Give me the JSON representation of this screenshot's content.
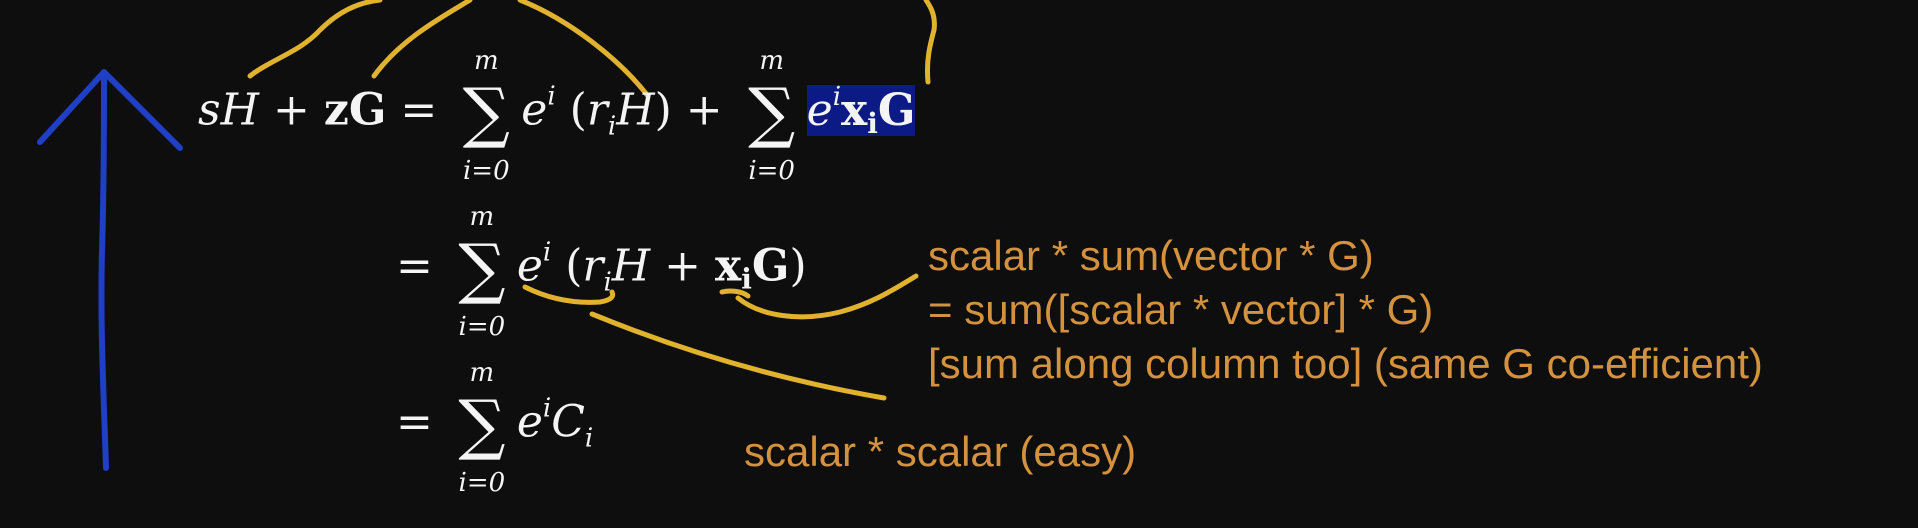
{
  "equations": {
    "line1": {
      "lhs_s": "s",
      "lhs_H": "H",
      "plus": "+",
      "lhs_z": "z",
      "lhs_G": "G",
      "equals": "=",
      "sum_upper": "m",
      "sum_lower": "i=0",
      "sigma": "∑",
      "e": "e",
      "i_sup": "i",
      "lparen": "(",
      "r": "r",
      "i_sub": "i",
      "H": "H",
      "rparen": ")",
      "plus2": "+",
      "x": "x",
      "x_sub": "i",
      "G": "G"
    },
    "line2": {
      "equals": "=",
      "sum_upper": "m",
      "sum_lower": "i=0",
      "sigma": "∑",
      "e": "e",
      "i_sup": "i",
      "lparen": "(",
      "r": "r",
      "i_sub": "i",
      "H": "H",
      "plus": "+",
      "x": "x",
      "x_sub": "i",
      "G": "G",
      "rparen": ")"
    },
    "line3": {
      "equals": "=",
      "sum_upper": "m",
      "sum_lower": "i=0",
      "sigma": "∑",
      "e": "e",
      "i_sup": "i",
      "C": "C",
      "C_sub": "i"
    }
  },
  "annotations": {
    "note1": "scalar * sum(vector * G)",
    "note2": "= sum([scalar * vector] * G)",
    "note3": "[sum along column too] (same G co-efficient)",
    "note4": "scalar * scalar (easy)"
  },
  "colors": {
    "background": "#0e0e0e",
    "math_text": "#f4f4f4",
    "annotation_text": "#d4923e",
    "yellow_ink": "#e0b22e",
    "blue_ink": "#1f3fc4",
    "highlight": "#0c1a86"
  }
}
